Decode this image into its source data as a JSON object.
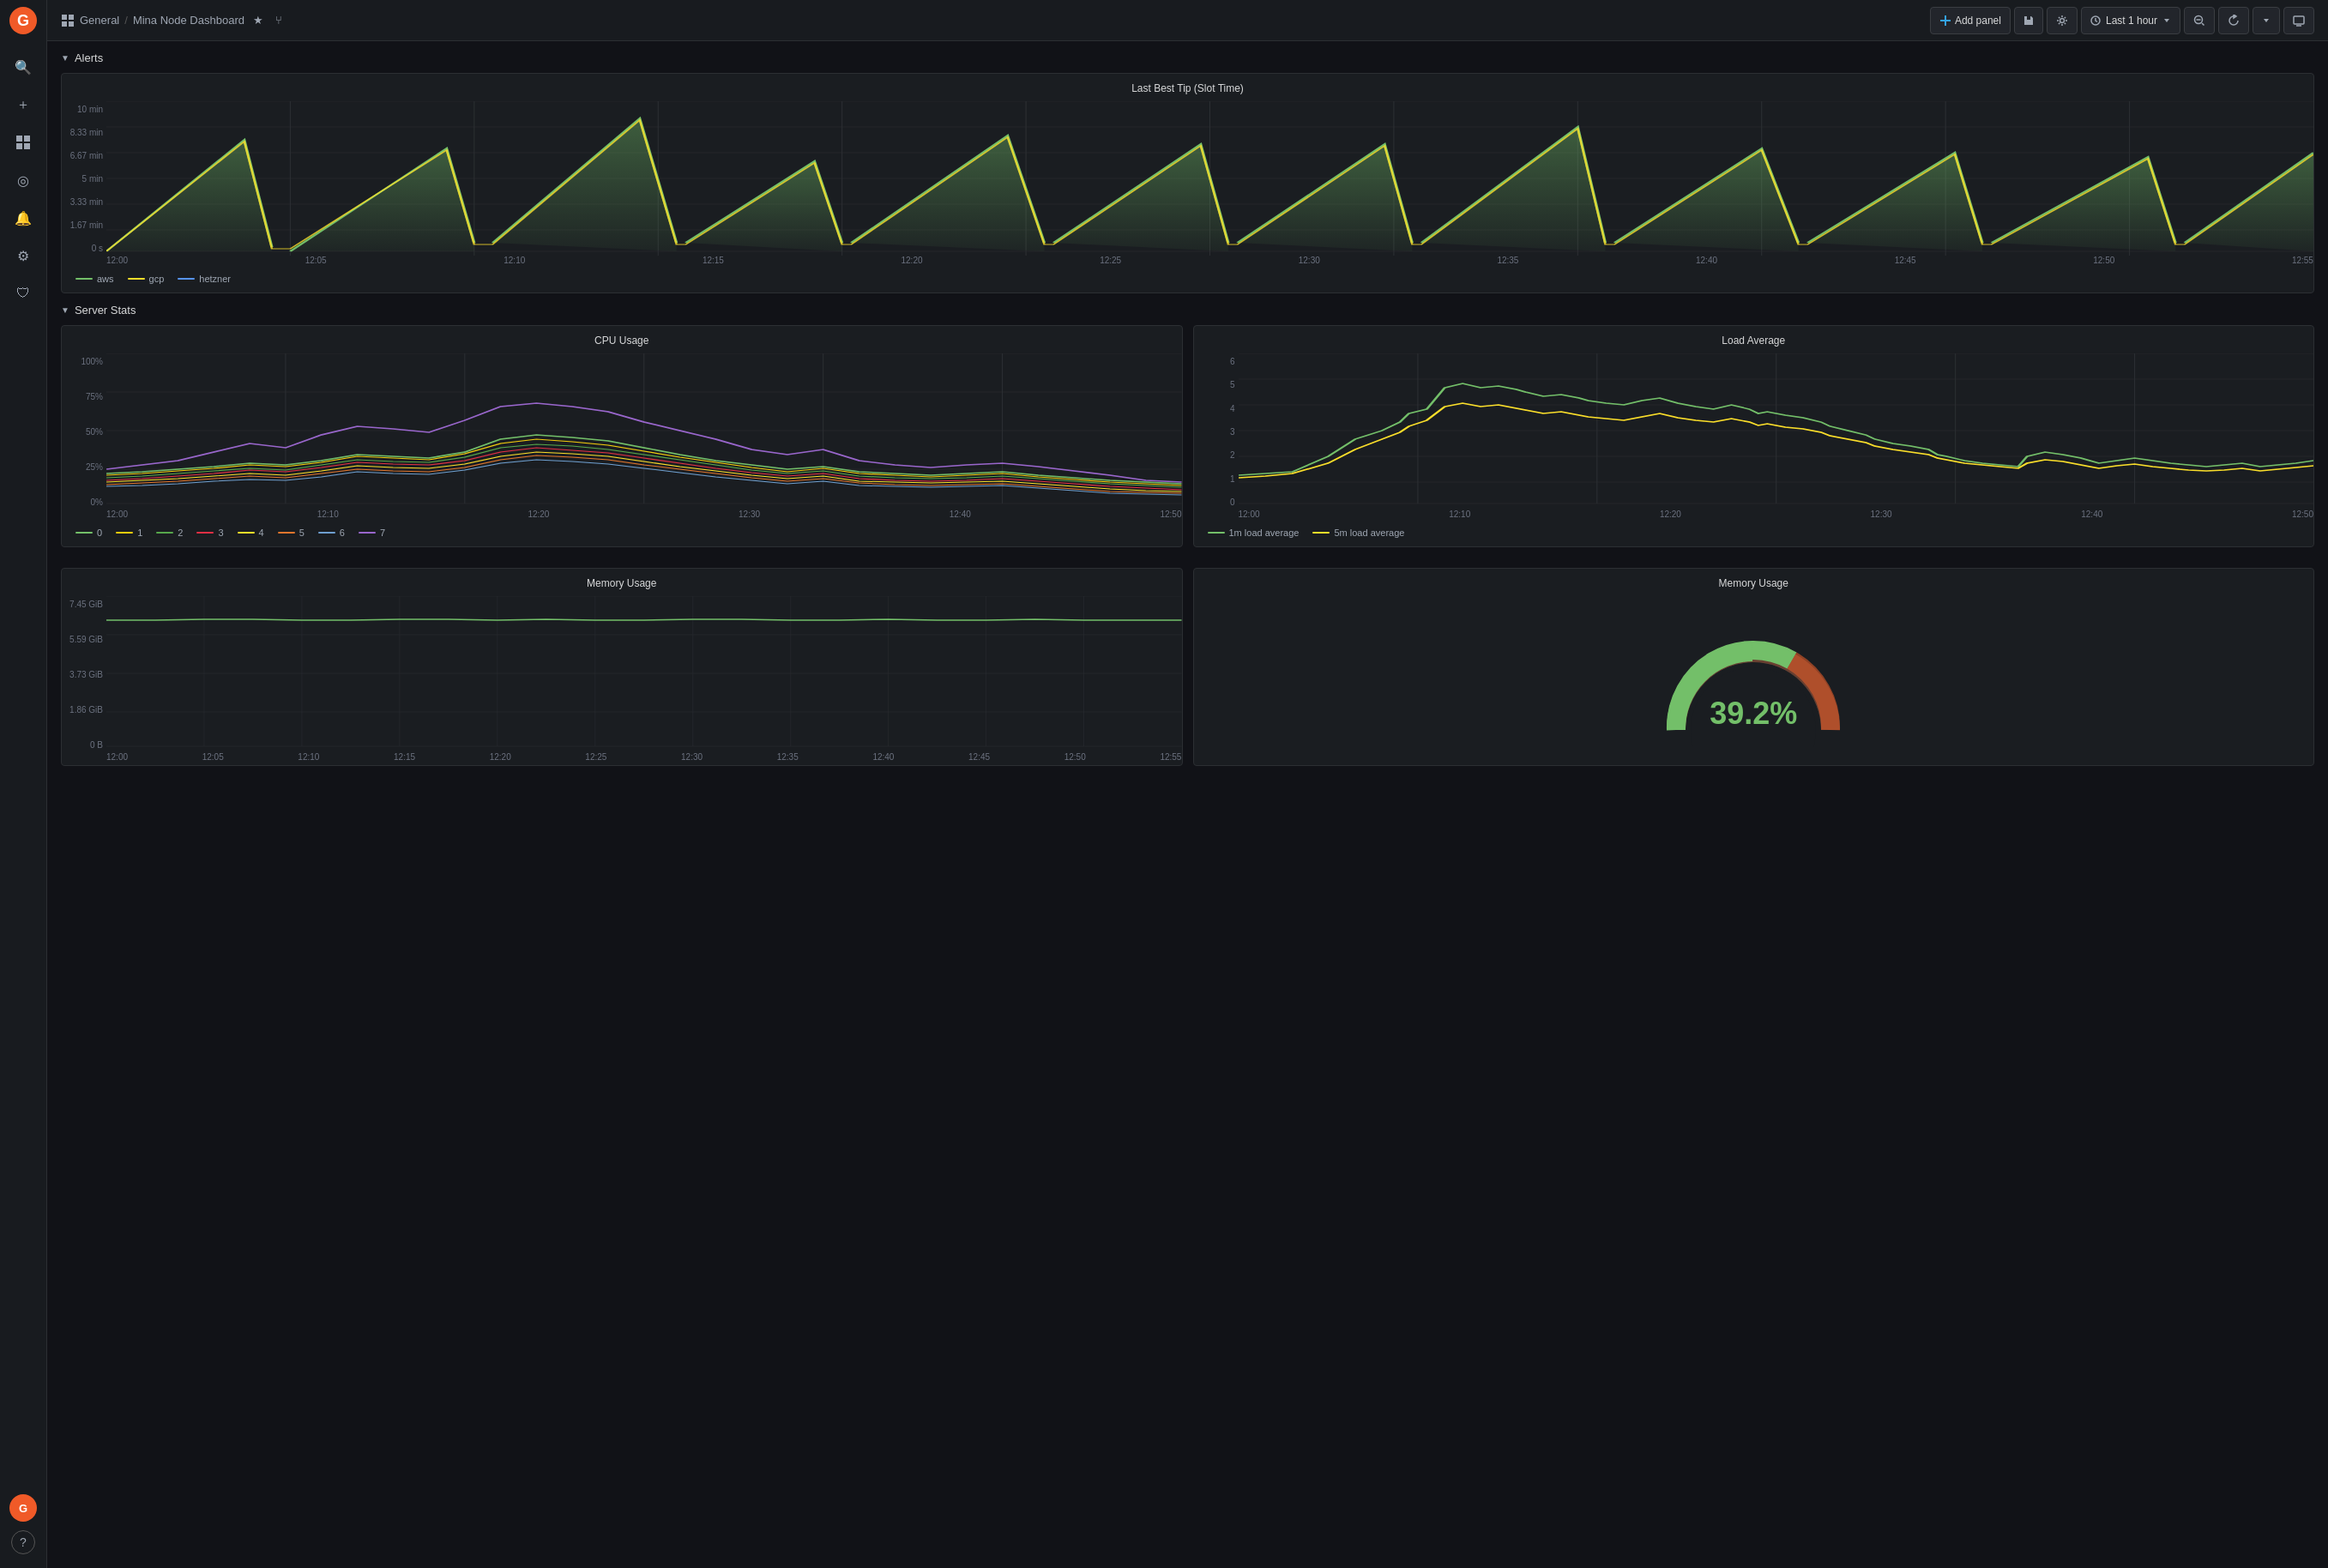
{
  "app": {
    "logo": "G",
    "logo_color": "#f05a28"
  },
  "sidebar": {
    "icons": [
      {
        "name": "search-icon",
        "symbol": "🔍"
      },
      {
        "name": "add-icon",
        "symbol": "+"
      },
      {
        "name": "dashboards-icon",
        "symbol": "⊞"
      },
      {
        "name": "explore-icon",
        "symbol": "◎"
      },
      {
        "name": "alerting-icon",
        "symbol": "🔔"
      },
      {
        "name": "settings-icon",
        "symbol": "⚙"
      },
      {
        "name": "shield-icon",
        "symbol": "🛡"
      }
    ],
    "avatar_initials": "G",
    "help_icon": "?"
  },
  "topbar": {
    "breadcrumb_parent": "General",
    "separator": "/",
    "title": "Mina Node Dashboard",
    "star_icon": "★",
    "share_icon": "⑂",
    "add_panel_label": "Add panel",
    "save_label": "Save",
    "settings_label": "Settings",
    "time_range_label": "Last 1 hour",
    "zoom_out_label": "Zoom out",
    "refresh_label": "Refresh",
    "display_label": "Display"
  },
  "sections": {
    "alerts": {
      "label": "Alerts",
      "collapsed": false
    },
    "server_stats": {
      "label": "Server Stats",
      "collapsed": false
    }
  },
  "panels": {
    "last_best_tip": {
      "title": "Last Best Tip (Slot Time)",
      "y_axis": [
        "10 min",
        "8.33 min",
        "6.67 min",
        "5 min",
        "3.33 min",
        "1.67 min",
        "0 s"
      ],
      "x_axis": [
        "12:00",
        "12:05",
        "12:10",
        "12:15",
        "12:20",
        "12:25",
        "12:30",
        "12:35",
        "12:40",
        "12:45",
        "12:50",
        "12:55"
      ],
      "legend": [
        {
          "label": "aws",
          "color": "#73bf69"
        },
        {
          "label": "gcp",
          "color": "#fade2a"
        },
        {
          "label": "hetzner",
          "color": "#5794f2"
        }
      ]
    },
    "cpu_usage": {
      "title": "CPU Usage",
      "y_axis": [
        "100%",
        "75%",
        "50%",
        "25%",
        "0%"
      ],
      "x_axis": [
        "12:00",
        "12:10",
        "12:20",
        "12:30",
        "12:40",
        "12:50"
      ],
      "legend": [
        {
          "label": "0",
          "color": "#73bf69"
        },
        {
          "label": "1",
          "color": "#f2cc0c"
        },
        {
          "label": "2",
          "color": "#56a64b"
        },
        {
          "label": "3",
          "color": "#e02f44"
        },
        {
          "label": "4",
          "color": "#fade2a"
        },
        {
          "label": "5",
          "color": "#e0752d"
        },
        {
          "label": "6",
          "color": "#6e9fcf"
        },
        {
          "label": "7",
          "color": "#9966cc"
        }
      ]
    },
    "load_average": {
      "title": "Load Average",
      "y_axis": [
        "6",
        "5",
        "4",
        "3",
        "2",
        "1",
        "0"
      ],
      "x_axis": [
        "12:00",
        "12:10",
        "12:20",
        "12:30",
        "12:40",
        "12:50"
      ],
      "legend": [
        {
          "label": "1m load average",
          "color": "#73bf69"
        },
        {
          "label": "5m load average",
          "color": "#fade2a"
        }
      ]
    },
    "memory_usage_chart": {
      "title": "Memory Usage",
      "y_axis": [
        "7.45 GiB",
        "5.59 GiB",
        "3.73 GiB",
        "1.86 GiB",
        "0 B"
      ],
      "x_axis": [
        "12:00",
        "12:05",
        "12:10",
        "12:15",
        "12:20",
        "12:25",
        "12:30",
        "12:35",
        "12:40",
        "12:45",
        "12:50",
        "12:55"
      ]
    },
    "memory_usage_gauge": {
      "title": "Memory Usage",
      "value": "39.2%",
      "value_color": "#73bf69",
      "gauge_pct": 39.2,
      "gauge_green_end": 60,
      "gauge_orange_start": 80
    }
  }
}
